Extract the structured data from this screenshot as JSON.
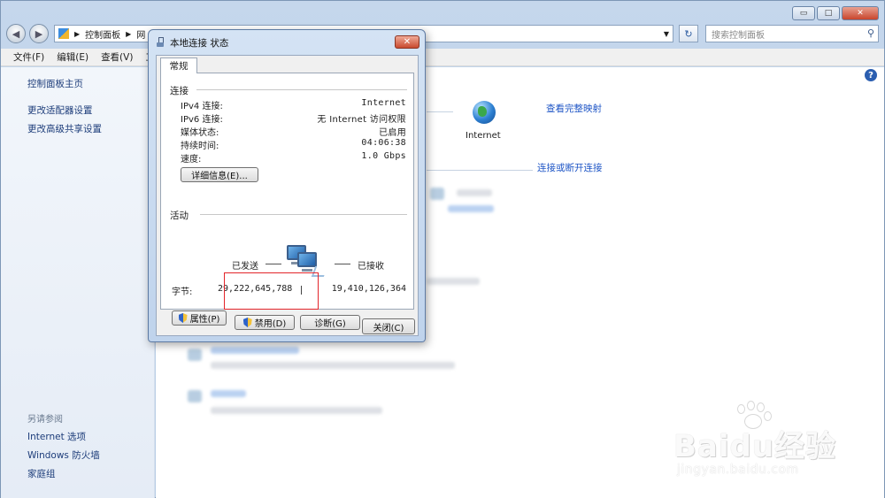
{
  "window": {
    "caption_buttons": {
      "minimize": "▭",
      "maximize": "□",
      "close": "✕"
    }
  },
  "addressbar": {
    "back_glyph": "◀",
    "forward_glyph": "▶",
    "breadcrumb": [
      "控制面板",
      "网"
    ],
    "dropdown_glyph": "▼",
    "refresh_glyph": "↻",
    "search_placeholder": "搜索控制面板",
    "search_icon": "search-icon"
  },
  "menubar": {
    "items": [
      "文件(F)",
      "编辑(E)",
      "查看(V)",
      "工具"
    ]
  },
  "sidebar": {
    "links": [
      "控制面板主页",
      "更改适配器设置",
      "更改高级共享设置"
    ],
    "see_also_heading": "另请参阅",
    "see_also_links": [
      "Internet 选项",
      "Windows 防火墙",
      "家庭组"
    ]
  },
  "content": {
    "view_full_map": "查看完整映射",
    "internet_label": "Internet",
    "connect_disconnect": "连接或断开连接",
    "help_glyph": "?"
  },
  "dialog": {
    "title": "本地连接 状态",
    "close_glyph": "✕",
    "tab": "常规",
    "connection": {
      "heading": "连接",
      "rows": [
        {
          "label": "IPv4 连接:",
          "value": "Internet"
        },
        {
          "label": "IPv6 连接:",
          "value": "无 Internet 访问权限"
        },
        {
          "label": "媒体状态:",
          "value": "已启用"
        },
        {
          "label": "持续时间:",
          "value": "04:06:38"
        },
        {
          "label": "速度:",
          "value": "1.0 Gbps"
        }
      ],
      "details_button": "详细信息(E)..."
    },
    "activity": {
      "heading": "活动",
      "sent_label": "已发送",
      "received_label": "已接收",
      "bytes_label": "字节:",
      "bytes_sent": "29,222,645,788",
      "bytes_received": "19,410,126,364"
    },
    "buttons": {
      "properties": "属性(P)",
      "disable": "禁用(D)",
      "diagnose": "诊断(G)"
    },
    "close_button": "关闭(C)"
  },
  "watermark": {
    "brand": "Baidu经验",
    "url": "jingyan.baidu.com"
  },
  "colors": {
    "link": "#1f56c6",
    "highlight": "#e3252a",
    "dialog_frame": "#bfd3ec"
  }
}
